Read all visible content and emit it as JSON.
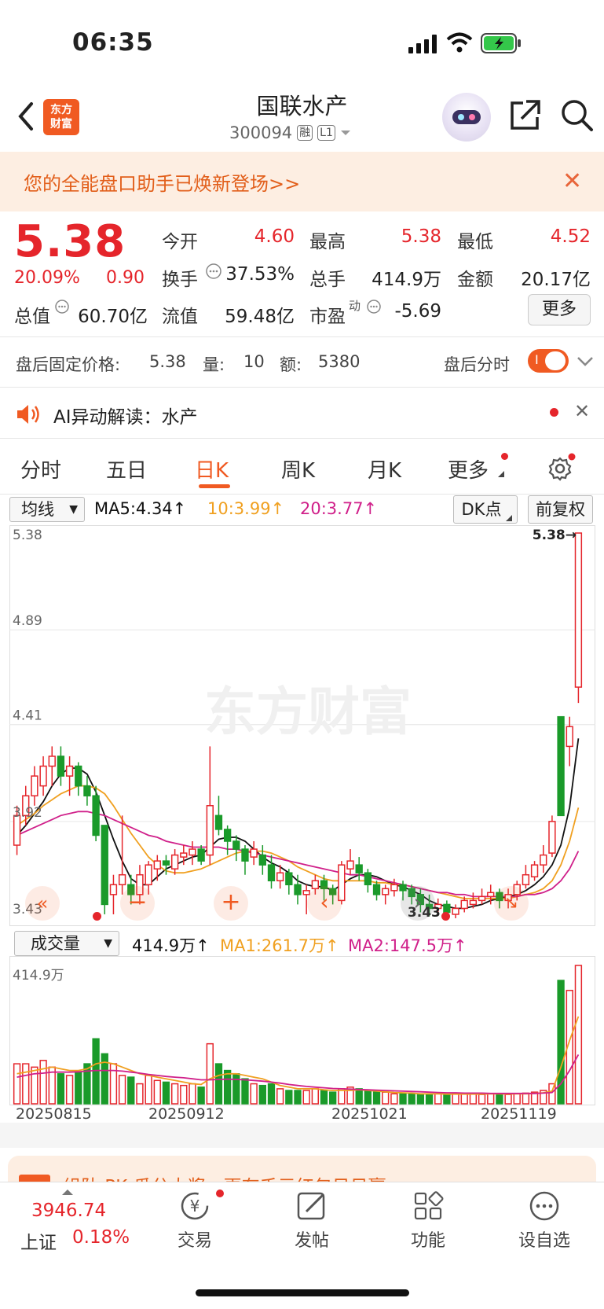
{
  "status_bar": {
    "time": "06:35"
  },
  "header": {
    "logo_text_1": "东方",
    "logo_text_2": "财富",
    "stock_name": "国联水产",
    "stock_code": "300094",
    "tag_margin": "融",
    "tag_level": "L1"
  },
  "banner": {
    "text": "您的全能盘口助手已焕新登场>>"
  },
  "quote": {
    "price": "5.38",
    "change_pct": "20.09%",
    "change": "0.90",
    "open_label": "今开",
    "open": "4.60",
    "high_label": "最高",
    "high": "5.38",
    "low_label": "最低",
    "low": "4.52",
    "turnover_label": "换手",
    "turnover": "37.53%",
    "volume_label": "总手",
    "volume": "414.9万",
    "amount_label": "金额",
    "amount": "20.17亿",
    "mktcap_label": "总值",
    "mktcap": "60.70亿",
    "float_label": "流值",
    "float_cap": "59.48亿",
    "pe_label": "市盈",
    "pe_sup": "动",
    "pe": "-5.69",
    "more_button": "更多"
  },
  "after_hours": {
    "label": "盘后固定价格:",
    "price": "5.38",
    "vol_label": "量:",
    "vol": "10",
    "amt_label": "额:",
    "amt": "5380",
    "timeshare_label": "盘后分时",
    "toggle_text": "I"
  },
  "ai": {
    "text": "AI异动解读：水产"
  },
  "tabs": [
    "分时",
    "五日",
    "日K",
    "周K",
    "月K",
    "更多"
  ],
  "active_tab": "日K",
  "indicators": {
    "ma_select": "均线",
    "ma5": "MA5:4.34↑",
    "ma10": "10:3.99↑",
    "ma20": "20:3.77↑",
    "dk_button": "DK点",
    "adjust_button": "前复权",
    "vol_select": "成交量",
    "vol_value": "414.9万↑",
    "vol_ma1": "MA1:261.7万↑",
    "vol_ma2": "MA2:147.5万↑"
  },
  "colors": {
    "up": "#e5252b",
    "down": "#1a9a2a",
    "ma5": "#111111",
    "ma10": "#f0a020",
    "ma20": "#d0208a",
    "accent": "#f05a22"
  },
  "chart_data": {
    "type": "candlestick",
    "y_ticks": [
      "5.38",
      "4.89",
      "4.41",
      "3.92",
      "3.43"
    ],
    "ylim": [
      3.43,
      5.38
    ],
    "x_ticks": [
      "20250815",
      "20250912",
      "20251021",
      "20251119"
    ],
    "max_label": "5.38→",
    "min_label": "3.43",
    "volume_y_label": "414.9万",
    "watermark": "东方财富",
    "candles": [
      [
        3.8,
        3.95,
        3.75,
        4.0
      ],
      [
        3.95,
        4.05,
        3.9,
        4.1
      ],
      [
        4.05,
        4.15,
        4.0,
        4.2
      ],
      [
        4.1,
        4.2,
        4.05,
        4.25
      ],
      [
        4.2,
        4.25,
        4.1,
        4.3
      ],
      [
        4.25,
        4.15,
        4.1,
        4.3
      ],
      [
        4.15,
        4.2,
        4.05,
        4.25
      ],
      [
        4.2,
        4.1,
        4.05,
        4.22
      ],
      [
        4.1,
        4.05,
        4.0,
        4.15
      ],
      [
        4.05,
        3.85,
        3.82,
        4.1
      ],
      [
        3.9,
        3.5,
        3.45,
        3.9
      ],
      [
        3.55,
        3.6,
        3.45,
        3.65
      ],
      [
        3.6,
        3.65,
        3.55,
        3.95
      ],
      [
        3.6,
        3.55,
        3.5,
        3.65
      ],
      [
        3.55,
        3.65,
        3.5,
        3.7
      ],
      [
        3.6,
        3.7,
        3.55,
        3.72
      ],
      [
        3.68,
        3.72,
        3.62,
        3.75
      ],
      [
        3.72,
        3.7,
        3.65,
        3.75
      ],
      [
        3.68,
        3.75,
        3.65,
        3.78
      ],
      [
        3.74,
        3.76,
        3.7,
        3.8
      ],
      [
        3.75,
        3.78,
        3.7,
        3.82
      ],
      [
        3.78,
        3.72,
        3.7,
        3.8
      ],
      [
        3.75,
        4.0,
        3.7,
        4.3
      ],
      [
        3.95,
        3.88,
        3.85,
        4.05
      ],
      [
        3.88,
        3.82,
        3.75,
        3.9
      ],
      [
        3.82,
        3.78,
        3.72,
        3.85
      ],
      [
        3.78,
        3.72,
        3.65,
        3.8
      ],
      [
        3.74,
        3.78,
        3.7,
        3.82
      ],
      [
        3.75,
        3.7,
        3.65,
        3.8
      ],
      [
        3.7,
        3.62,
        3.58,
        3.75
      ],
      [
        3.62,
        3.66,
        3.58,
        3.7
      ],
      [
        3.66,
        3.6,
        3.55,
        3.68
      ],
      [
        3.6,
        3.55,
        3.5,
        3.65
      ],
      [
        3.55,
        3.57,
        3.45,
        3.6
      ],
      [
        3.58,
        3.62,
        3.55,
        3.65
      ],
      [
        3.62,
        3.58,
        3.52,
        3.65
      ],
      [
        3.58,
        3.55,
        3.5,
        3.6
      ],
      [
        3.52,
        3.7,
        3.5,
        3.72
      ],
      [
        3.68,
        3.72,
        3.65,
        3.78
      ],
      [
        3.7,
        3.66,
        3.62,
        3.74
      ],
      [
        3.66,
        3.6,
        3.56,
        3.68
      ],
      [
        3.6,
        3.55,
        3.52,
        3.62
      ],
      [
        3.55,
        3.58,
        3.5,
        3.6
      ],
      [
        3.57,
        3.6,
        3.54,
        3.63
      ],
      [
        3.6,
        3.57,
        3.52,
        3.62
      ],
      [
        3.58,
        3.54,
        3.5,
        3.6
      ],
      [
        3.55,
        3.5,
        3.46,
        3.58
      ],
      [
        3.5,
        3.48,
        3.44,
        3.55
      ],
      [
        3.48,
        3.5,
        3.45,
        3.53
      ],
      [
        3.5,
        3.46,
        3.43,
        3.52
      ],
      [
        3.45,
        3.48,
        3.43,
        3.5
      ],
      [
        3.48,
        3.52,
        3.46,
        3.54
      ],
      [
        3.5,
        3.52,
        3.48,
        3.56
      ],
      [
        3.52,
        3.54,
        3.5,
        3.58
      ],
      [
        3.54,
        3.56,
        3.5,
        3.6
      ],
      [
        3.56,
        3.52,
        3.48,
        3.58
      ],
      [
        3.52,
        3.55,
        3.48,
        3.58
      ],
      [
        3.55,
        3.6,
        3.52,
        3.62
      ],
      [
        3.6,
        3.65,
        3.58,
        3.7
      ],
      [
        3.64,
        3.7,
        3.62,
        3.72
      ],
      [
        3.7,
        3.75,
        3.66,
        3.8
      ],
      [
        3.76,
        3.92,
        3.74,
        3.95
      ],
      [
        4.45,
        3.95,
        3.95,
        4.45
      ],
      [
        4.3,
        4.4,
        4.2,
        4.45
      ],
      [
        4.6,
        5.38,
        4.52,
        5.38
      ]
    ],
    "ma5": [
      3.85,
      3.9,
      3.96,
      4.02,
      4.1,
      4.16,
      4.19,
      4.19,
      4.16,
      4.07,
      3.95,
      3.83,
      3.72,
      3.63,
      3.6,
      3.6,
      3.64,
      3.68,
      3.7,
      3.72,
      3.74,
      3.75,
      3.79,
      3.83,
      3.84,
      3.84,
      3.82,
      3.78,
      3.74,
      3.71,
      3.69,
      3.66,
      3.62,
      3.6,
      3.59,
      3.59,
      3.57,
      3.6,
      3.63,
      3.65,
      3.65,
      3.64,
      3.62,
      3.6,
      3.59,
      3.57,
      3.55,
      3.52,
      3.5,
      3.49,
      3.48,
      3.48,
      3.49,
      3.5,
      3.52,
      3.53,
      3.54,
      3.55,
      3.57,
      3.6,
      3.64,
      3.7,
      3.8,
      3.99,
      4.34
    ],
    "ma10": [
      3.9,
      3.93,
      3.96,
      4.0,
      4.03,
      4.06,
      4.08,
      4.1,
      4.1,
      4.09,
      4.06,
      4.0,
      3.93,
      3.86,
      3.8,
      3.74,
      3.7,
      3.67,
      3.66,
      3.66,
      3.67,
      3.68,
      3.7,
      3.72,
      3.74,
      3.76,
      3.77,
      3.77,
      3.77,
      3.76,
      3.74,
      3.72,
      3.69,
      3.67,
      3.65,
      3.63,
      3.62,
      3.62,
      3.62,
      3.62,
      3.62,
      3.61,
      3.61,
      3.6,
      3.6,
      3.59,
      3.58,
      3.57,
      3.56,
      3.55,
      3.54,
      3.53,
      3.53,
      3.53,
      3.53,
      3.53,
      3.53,
      3.54,
      3.55,
      3.56,
      3.58,
      3.62,
      3.7,
      3.82,
      3.99
    ],
    "ma20": [
      3.85,
      3.87,
      3.89,
      3.91,
      3.93,
      3.95,
      3.96,
      3.97,
      3.97,
      3.96,
      3.95,
      3.93,
      3.91,
      3.89,
      3.87,
      3.85,
      3.84,
      3.82,
      3.81,
      3.8,
      3.79,
      3.79,
      3.79,
      3.79,
      3.78,
      3.78,
      3.77,
      3.76,
      3.75,
      3.74,
      3.73,
      3.72,
      3.71,
      3.7,
      3.69,
      3.68,
      3.67,
      3.66,
      3.65,
      3.65,
      3.64,
      3.63,
      3.62,
      3.61,
      3.6,
      3.59,
      3.58,
      3.57,
      3.56,
      3.56,
      3.55,
      3.55,
      3.54,
      3.54,
      3.54,
      3.54,
      3.54,
      3.54,
      3.55,
      3.55,
      3.56,
      3.58,
      3.62,
      3.68,
      3.77
    ],
    "volume_ylim": [
      0,
      414.9
    ],
    "volumes": [
      120,
      120,
      110,
      130,
      110,
      90,
      85,
      95,
      120,
      195,
      150,
      120,
      85,
      80,
      60,
      85,
      70,
      65,
      60,
      55,
      60,
      50,
      180,
      120,
      100,
      90,
      75,
      60,
      55,
      60,
      45,
      40,
      40,
      40,
      45,
      40,
      35,
      45,
      50,
      45,
      40,
      35,
      35,
      30,
      30,
      30,
      28,
      28,
      30,
      28,
      30,
      32,
      30,
      28,
      30,
      30,
      28,
      30,
      32,
      35,
      40,
      60,
      370,
      340,
      414.9
    ],
    "vol_ma1": [
      90,
      95,
      100,
      105,
      110,
      105,
      100,
      100,
      105,
      120,
      125,
      120,
      110,
      100,
      90,
      85,
      80,
      75,
      70,
      65,
      60,
      58,
      75,
      85,
      90,
      90,
      85,
      80,
      75,
      65,
      55,
      50,
      45,
      45,
      45,
      42,
      40,
      40,
      40,
      42,
      40,
      38,
      36,
      34,
      33,
      32,
      30,
      30,
      30,
      29,
      29,
      29,
      29,
      29,
      30,
      30,
      29,
      30,
      30,
      31,
      33,
      38,
      110,
      190,
      261.7
    ],
    "vol_ma2": [
      80,
      85,
      90,
      92,
      95,
      95,
      95,
      96,
      98,
      100,
      100,
      100,
      98,
      95,
      92,
      88,
      85,
      82,
      80,
      78,
      75,
      72,
      72,
      73,
      74,
      73,
      72,
      70,
      68,
      65,
      62,
      58,
      55,
      52,
      50,
      48,
      46,
      45,
      44,
      43,
      42,
      41,
      40,
      39,
      38,
      37,
      36,
      35,
      34,
      33,
      33,
      32,
      32,
      32,
      31,
      31,
      31,
      31,
      31,
      31,
      32,
      34,
      60,
      100,
      147.5
    ]
  },
  "bottom_banner": {
    "text": "组队 PK 瓜分大奖，更有千元红包日日赢>>"
  },
  "bottom_nav": {
    "index_value": "3946.74",
    "index_name": "上证",
    "index_pct": "0.18%",
    "items": [
      "交易",
      "发帖",
      "功能",
      "设自选"
    ]
  }
}
